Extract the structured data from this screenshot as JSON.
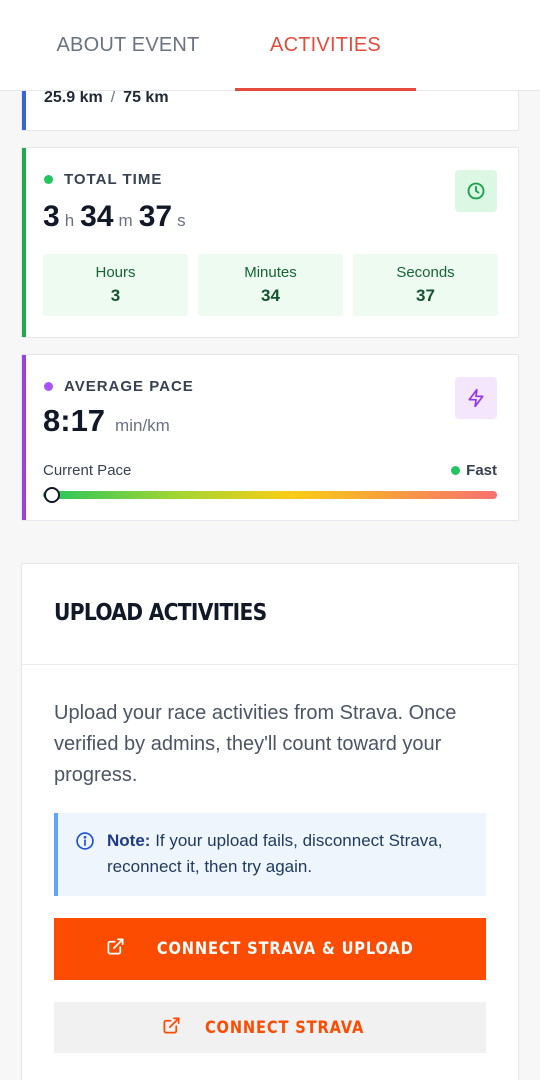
{
  "tabs": {
    "about": "ABOUT EVENT",
    "activities": "ACTIVITIES",
    "active": "activities"
  },
  "distance": {
    "current": "25.9 km",
    "separator": "/",
    "goal": "75 km",
    "accent_color": "#3b63d8"
  },
  "total_time": {
    "label": "TOTAL TIME",
    "icon": "clock-icon",
    "hours": "3",
    "h_unit": "h",
    "minutes": "34",
    "m_unit": "m",
    "seconds": "37",
    "s_unit": "s",
    "accent_color": "#22a94f",
    "breakdown": [
      {
        "label": "Hours",
        "value": "3"
      },
      {
        "label": "Minutes",
        "value": "34"
      },
      {
        "label": "Seconds",
        "value": "37"
      }
    ]
  },
  "average_pace": {
    "label": "AVERAGE PACE",
    "icon": "lightning-icon",
    "value": "8:17",
    "unit": "min/km",
    "current_label": "Current Pace",
    "fast_label": "Fast",
    "pace_level": 0.02,
    "accent_color": "#9b3fe0"
  },
  "upload": {
    "title": "UPLOAD ACTIVITIES",
    "description": "Upload your race activities from Strava. Once verified by admins, they'll count toward your progress.",
    "note_bold": "Note:",
    "note_text": "If your upload fails, disconnect Strava, reconnect it, then try again.",
    "primary_button": "CONNECT STRAVA & UPLOAD",
    "secondary_button": "CONNECT STRAVA",
    "button_icon": "external-link-icon",
    "brand_color": "#fc4c02"
  }
}
